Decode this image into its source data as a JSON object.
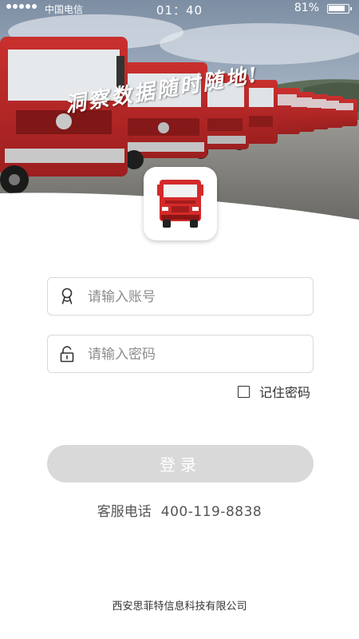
{
  "status_bar": {
    "carrier": "中国电信",
    "time": "01：40",
    "battery": "81%"
  },
  "hero": {
    "slogan": "洞察数据随时随地!"
  },
  "login_form": {
    "account_placeholder": "请输入账号",
    "password_placeholder": "请输入密码",
    "remember_label": "记住密码",
    "login_button_label": "登录",
    "remember_checked": false
  },
  "support": {
    "label": "客服电话",
    "phone": "400-119-8838"
  },
  "footer": {
    "company": "西安思菲特信息科技有限公司"
  },
  "colors": {
    "button_disabled": "#d9d9d9",
    "truck_red": "#d42a2a",
    "field_border": "#d9d9d9"
  },
  "icons": {
    "account": "user-icon",
    "password": "lock-icon",
    "app": "truck-icon"
  }
}
